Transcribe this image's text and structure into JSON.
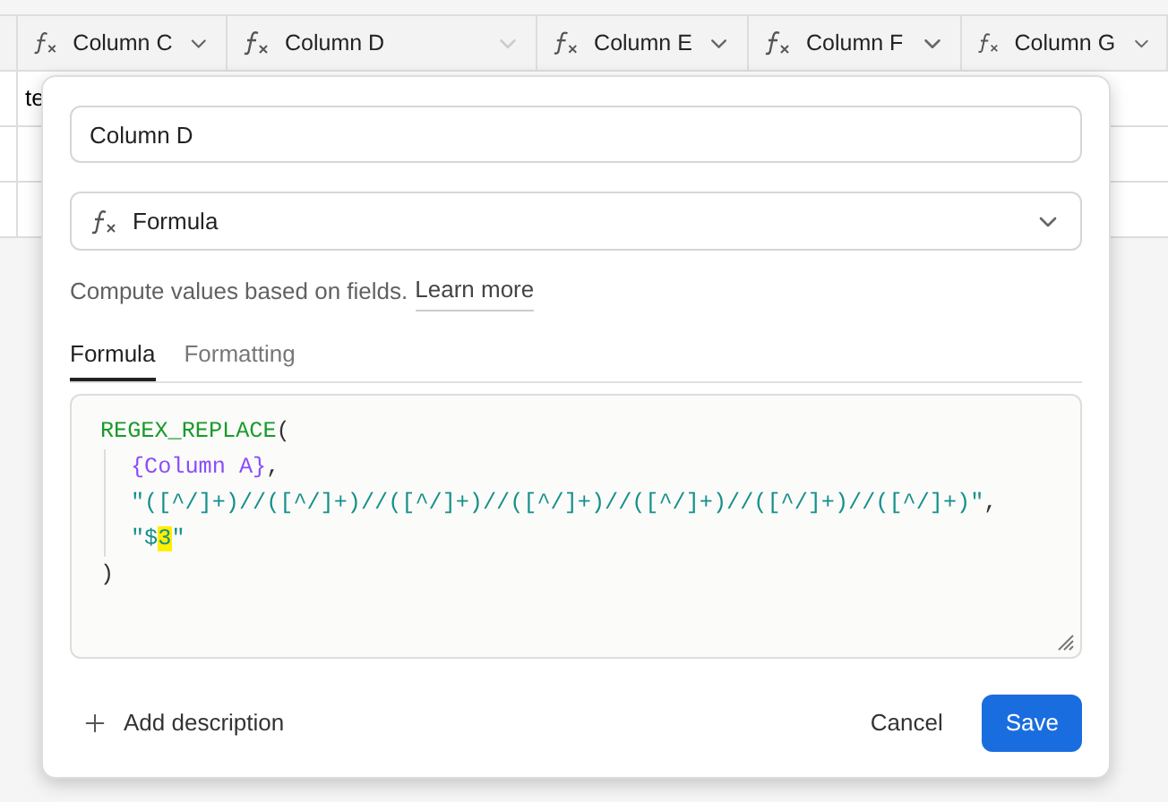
{
  "grid": {
    "columns": [
      {
        "label": "Column C",
        "dimmed": false
      },
      {
        "label": "Column D",
        "dimmed": true
      },
      {
        "label": "Column E",
        "dimmed": false
      },
      {
        "label": "Column F",
        "dimmed": false
      },
      {
        "label": "Column G",
        "dimmed": false
      }
    ],
    "cell_text": "te"
  },
  "dialog": {
    "name_value": "Column D",
    "type_value": "Formula",
    "help_text": "Compute values based on fields.",
    "help_link": "Learn more",
    "tabs": [
      {
        "label": "Formula",
        "selected": true
      },
      {
        "label": "Formatting",
        "selected": false
      }
    ],
    "code_lines": [
      {
        "indent": false,
        "segments": [
          {
            "text": "REGEX_REPLACE",
            "kind": "function"
          },
          {
            "text": "(",
            "kind": "plain"
          }
        ]
      },
      {
        "indent": true,
        "segments": [
          {
            "text": "{Column A}",
            "kind": "field"
          },
          {
            "text": ",",
            "kind": "plain"
          }
        ]
      },
      {
        "indent": true,
        "segments": [
          {
            "text": "\"([^/]+)//([^/]+)//([^/]+)//([^/]+)//([^/]+)//([^/]+)//([^/]+)\"",
            "kind": "string"
          },
          {
            "text": ",",
            "kind": "plain"
          }
        ]
      },
      {
        "indent": true,
        "segments": [
          {
            "text": "\"$",
            "kind": "string"
          },
          {
            "text": "3",
            "kind": "highlight"
          },
          {
            "text": "\"",
            "kind": "string"
          }
        ]
      },
      {
        "indent": false,
        "segments": [
          {
            "text": ")",
            "kind": "plain"
          }
        ]
      }
    ],
    "add_description": "Add description",
    "cancel": "Cancel",
    "save": "Save"
  }
}
